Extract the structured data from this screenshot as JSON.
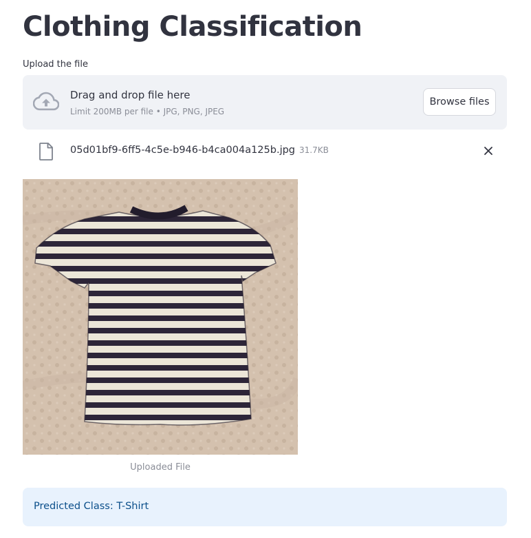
{
  "page": {
    "title": "Clothing Classification"
  },
  "uploader": {
    "label": "Upload the file",
    "drop_text": "Drag and drop file here",
    "limit_text": "Limit 200MB per file • JPG, PNG, JPEG",
    "browse_label": "Browse files",
    "icon": "cloud-upload-icon"
  },
  "file": {
    "name": "05d01bf9-6ff5-4c5e-b946-b4ca004a125b.jpg",
    "size": "31.7KB",
    "icon": "file-icon"
  },
  "image": {
    "caption": "Uploaded File"
  },
  "result": {
    "text": "Predicted Class: T-Shirt"
  },
  "colors": {
    "text": "#31333f",
    "muted": "#8a8d97",
    "dropzone_bg": "#f0f2f6",
    "alert_bg": "#e8f2fd",
    "alert_text": "#0b4f8a"
  }
}
